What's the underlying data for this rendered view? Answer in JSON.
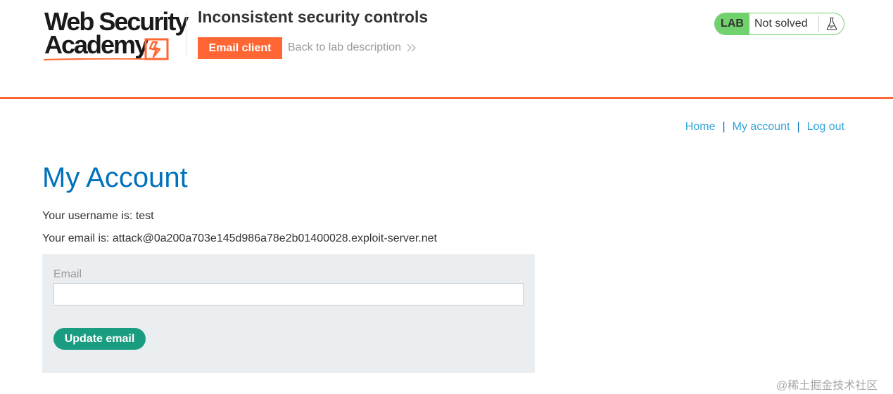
{
  "header": {
    "logo": {
      "line1": "Web Security",
      "line2": "Academy"
    },
    "lab_title": "Inconsistent security controls",
    "email_client_label": "Email client",
    "back_link_label": "Back to lab description",
    "status": {
      "badge": "LAB",
      "text": "Not solved"
    }
  },
  "nav": {
    "home": "Home",
    "my_account": "My account",
    "log_out": "Log out",
    "separator": "|"
  },
  "main": {
    "title": "My Account",
    "username_line": "Your username is: test",
    "email_line": "Your email is: attack@0a200a703e145d986a78e2b01400028.exploit-server.net",
    "form": {
      "email_label": "Email",
      "email_value": "",
      "submit_label": "Update email"
    }
  },
  "watermark": "@稀土掘金技术社区",
  "colors": {
    "brand_orange": "#ff6633",
    "link_blue": "#0071bc",
    "lab_green": "#70d16d",
    "button_green": "#1a9c80",
    "panel_gray": "#ebeef0"
  }
}
